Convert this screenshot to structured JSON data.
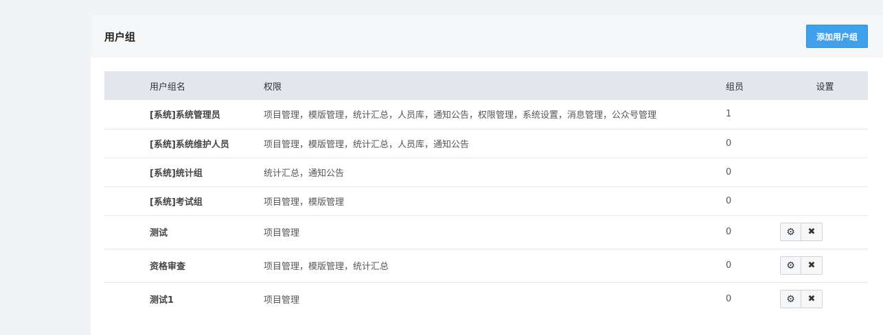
{
  "header": {
    "title": "用户组",
    "add_button_label": "添加用户组"
  },
  "table": {
    "columns": [
      "用户组名",
      "权限",
      "组员",
      "设置"
    ],
    "rows": [
      {
        "name": "[系统]系统管理员",
        "perms": "项目管理，模版管理，统计汇总，人员库，通知公告，权限管理，系统设置，消息管理，公众号管理",
        "members": "1",
        "editable": false
      },
      {
        "name": "[系统]系统维护人员",
        "perms": "项目管理，模版管理，统计汇总，人员库，通知公告",
        "members": "0",
        "editable": false
      },
      {
        "name": "[系统]统计组",
        "perms": "统计汇总，通知公告",
        "members": "0",
        "editable": false
      },
      {
        "name": "[系统]考试组",
        "perms": "项目管理，模版管理",
        "members": "0",
        "editable": false
      },
      {
        "name": "测试",
        "perms": "项目管理",
        "members": "0",
        "editable": true
      },
      {
        "name": "资格审查",
        "perms": "项目管理，模版管理，统计汇总",
        "members": "0",
        "editable": true
      },
      {
        "name": "测试1",
        "perms": "项目管理",
        "members": "0",
        "editable": true
      }
    ]
  },
  "icons": {
    "settings": "gears-icon",
    "delete": "close-icon"
  },
  "colors": {
    "accent": "#3fa1ec",
    "table_header_bg": "#e3e6ed"
  }
}
